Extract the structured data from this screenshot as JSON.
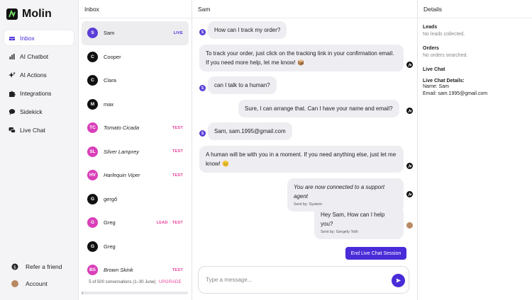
{
  "app": {
    "name": "Molin",
    "accent": "#4a2bd8",
    "pink": "#e8399a"
  },
  "sidebar": {
    "items": [
      {
        "label": "Inbox",
        "icon": "inbox-icon",
        "active": true
      },
      {
        "label": "AI Chatbot",
        "icon": "bar-chart-icon"
      },
      {
        "label": "AI Actions",
        "icon": "sparkles-icon"
      },
      {
        "label": "Integrations",
        "icon": "puzzle-icon"
      },
      {
        "label": "Sidekick",
        "icon": "chat-bubble-icon"
      },
      {
        "label": "Live Chat",
        "icon": "live-chat-icon"
      }
    ],
    "bottom": [
      {
        "label": "Refer a friend",
        "icon": "dollar-icon"
      },
      {
        "label": "Account",
        "icon": "avatar"
      }
    ]
  },
  "inbox": {
    "title": "Inbox",
    "conversations": [
      {
        "initials": "S",
        "name": "Sam",
        "color": "#5b3ed8",
        "tags": [
          "LIVE"
        ],
        "active": true
      },
      {
        "initials": "C",
        "name": "Cooper",
        "color": "#111111",
        "tags": []
      },
      {
        "initials": "C",
        "name": "Clara",
        "color": "#111111",
        "tags": []
      },
      {
        "initials": "M",
        "name": "max",
        "color": "#111111",
        "tags": []
      },
      {
        "initials": "TC",
        "name": "Tomato Cicada",
        "color": "#d93fb8",
        "tags": [
          "TEST"
        ],
        "italic": true
      },
      {
        "initials": "SL",
        "name": "Silver Lamprey",
        "color": "#d93fb8",
        "tags": [
          "TEST"
        ],
        "italic": true
      },
      {
        "initials": "HV",
        "name": "Harlequin Viper",
        "color": "#d93fb8",
        "tags": [
          "TEST"
        ],
        "italic": true
      },
      {
        "initials": "G",
        "name": "gergő",
        "color": "#111111",
        "tags": []
      },
      {
        "initials": "G",
        "name": "Greg",
        "color": "#d93fb8",
        "tags": [
          "LEAD",
          "TEST"
        ]
      },
      {
        "initials": "G",
        "name": "Greg",
        "color": "#111111",
        "tags": []
      },
      {
        "initials": "BS",
        "name": "Brown Skink",
        "color": "#d93fb8",
        "tags": [
          "TEST"
        ],
        "italic": true
      }
    ],
    "footer_text": "5 of 500 conversations (1–30 June)",
    "upgrade_label": "UPGRADE",
    "usage_fraction": 0.01
  },
  "chat": {
    "title": "Sam",
    "messages": [
      {
        "from": "user",
        "text": "How can I track my order?"
      },
      {
        "from": "bot",
        "text": "To track your order, just click on the tracking link in your confirmation email. If you need more help, let me know! 📦"
      },
      {
        "from": "user",
        "text": "can I talk to a human?"
      },
      {
        "from": "bot",
        "text": "Sure, I can arrange that. Can I have your name and email?"
      },
      {
        "from": "user",
        "text": "Sam, sam.1995@gmail.com"
      },
      {
        "from": "bot",
        "text": "A human will be with you in a moment. If you need anything else, just let me know! 😊"
      },
      {
        "from": "system",
        "text": "You are now connected to a support agent",
        "sub": "Sent by: System"
      },
      {
        "from": "agent",
        "text": "Hey Sam, How can I help you?",
        "sub": "Sent by: Gergely Toth"
      }
    ],
    "user_initial": "S",
    "end_session_label": "End Live Chat Session",
    "composer_placeholder": "Type a message..."
  },
  "details": {
    "title": "Details",
    "leads_h": "Leads",
    "leads_t": "No leads collected.",
    "orders_h": "Orders",
    "orders_t": "No orders searched.",
    "live_h": "Live Chat",
    "live_details_h": "Live Chat Details:",
    "name_line": "Name: Sam",
    "email_line": "Email: sam.1995@gmail.com"
  }
}
